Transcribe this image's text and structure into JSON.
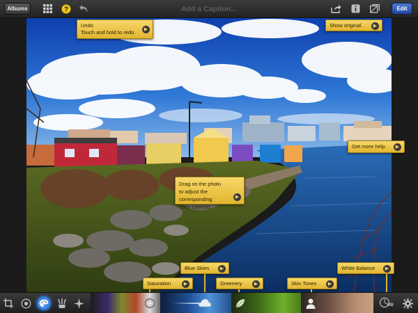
{
  "toolbar": {
    "albums_label": "Albums",
    "caption_placeholder": "Add a Caption...",
    "edit_label": "Edit",
    "icons": [
      "grid-icon",
      "help-icon",
      "undo-icon",
      "share-icon",
      "info-icon",
      "compare-icon"
    ]
  },
  "tips": {
    "undo_title": "Undo",
    "undo_body": "Touch and hold to redo.",
    "show_original": "Show original.",
    "more_help": "Get more help.",
    "drag_line1": "Drag on the photo",
    "drag_line2": "to adjust the corresponding",
    "drag_line3": "color controls.",
    "saturation": "Saturation",
    "blue_skies": "Blue Skies",
    "greenery": "Greenery",
    "skin_tones": "Skin Tones",
    "white_balance": "White Balance"
  },
  "bottom": {
    "tools": [
      "crop-icon",
      "exposure-icon",
      "color-icon",
      "brushes-icon",
      "effects-icon"
    ],
    "wb_label": "WB",
    "active_tool": "color-icon"
  },
  "colors": {
    "tip_yellow": "#e9c13f",
    "edit_blue": "#3a65c4",
    "active_blue": "#3a8cf0"
  }
}
